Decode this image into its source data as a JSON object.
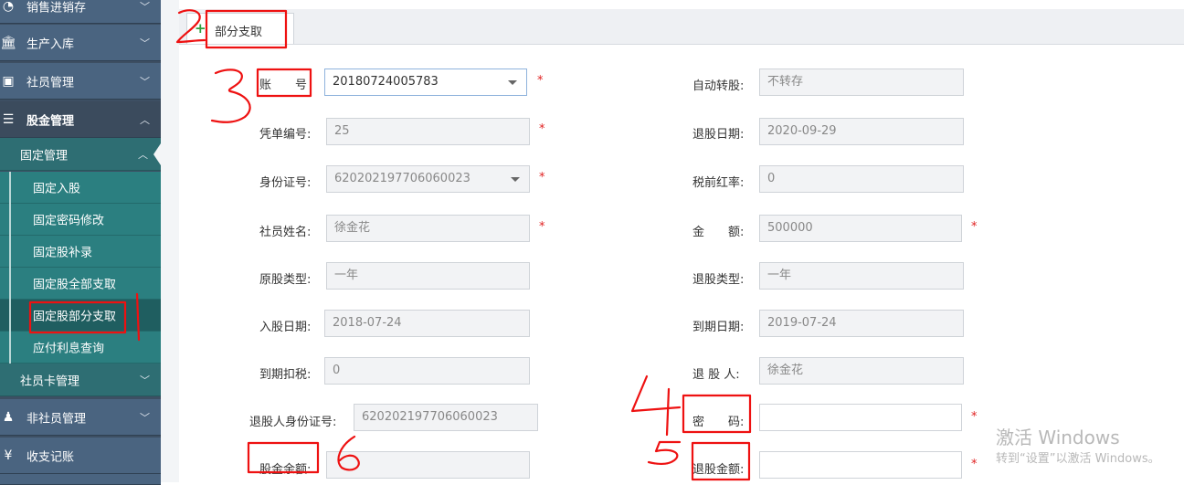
{
  "sidebar": {
    "items": [
      {
        "label": "销售进销存",
        "icon": "pie-chart-icon"
      },
      {
        "label": "生产入库",
        "icon": "bank-icon"
      },
      {
        "label": "社员管理",
        "icon": "picture-icon"
      },
      {
        "label": "股金管理",
        "icon": "database-icon"
      },
      {
        "label": "固定管理"
      },
      {
        "label": "固定入股"
      },
      {
        "label": "固定密码修改"
      },
      {
        "label": "固定股补录"
      },
      {
        "label": "固定股全部支取"
      },
      {
        "label": "固定股部分支取"
      },
      {
        "label": "应付利息查询"
      },
      {
        "label": "社员卡管理"
      },
      {
        "label": "非社员管理",
        "icon": "person-icon"
      },
      {
        "label": "收支记账",
        "icon": "yen-icon"
      }
    ]
  },
  "tab": {
    "label": "部分支取"
  },
  "form": {
    "account_label": "账　　号",
    "account_value": "20180724005783",
    "auto_transfer_label": "自动转股:",
    "auto_transfer_value": "不转存",
    "voucher_label": "凭单编号:",
    "voucher_value": "25",
    "withdraw_date_label": "退股日期:",
    "withdraw_date_value": "2020-09-29",
    "idcard_label": "身份证号:",
    "idcard_value": "620202197706060023",
    "pretax_rate_label": "税前红率:",
    "pretax_rate_value": "0",
    "member_name_label": "社员姓名:",
    "member_name_value": "徐金花",
    "amount_label": "金　　额:",
    "amount_value": "500000",
    "orig_type_label": "原股类型:",
    "orig_type_value": "一年",
    "withdraw_type_label": "退股类型:",
    "withdraw_type_value": "一年",
    "join_date_label": "入股日期:",
    "join_date_value": "2018-07-24",
    "due_date_label": "到期日期:",
    "due_date_value": "2019-07-24",
    "due_tax_label": "到期扣税:",
    "due_tax_value": "0",
    "withdrawer_label": "退 股 人:",
    "withdrawer_value": "徐金花",
    "withdrawer_id_label": "退股人身份证号:",
    "withdrawer_id_value": "620202197706060023",
    "password_label": "密　　码:",
    "password_value": "",
    "balance_label": "股金余额:",
    "balance_value": "",
    "withdraw_amount_label": "退股金额:",
    "withdraw_amount_value": "",
    "required_mark": "*"
  },
  "annotations": [
    "1",
    "2",
    "3",
    "4",
    "5",
    "6"
  ],
  "watermark": {
    "line1": "激活 Windows",
    "line2": "转到“设置”以激活 Windows。"
  }
}
